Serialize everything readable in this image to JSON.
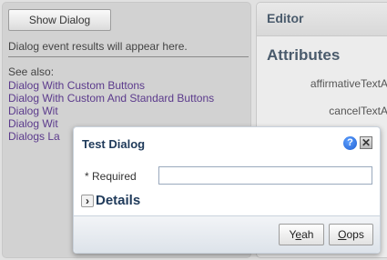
{
  "left": {
    "show_dialog_label": "Show Dialog",
    "results_text": "Dialog event results will appear here.",
    "see_also_label": "See also:",
    "see_also_links": [
      "Dialog With Custom Buttons",
      "Dialog With Custom And Standard Buttons",
      "Dialog Wit",
      "Dialog Wit",
      "Dialogs La"
    ]
  },
  "editor": {
    "title": "Editor",
    "attributes_title": "Attributes",
    "attributes": [
      "affirmativeTextAr",
      "cancelTextAr"
    ]
  },
  "dialog": {
    "title": "Test Dialog",
    "help_glyph": "?",
    "close_glyph": "✕",
    "required_star": "*",
    "required_label": "Required",
    "required_value": "",
    "details_chevron": "›",
    "details_label": "Details",
    "yeah_label_pre": "Y",
    "yeah_label_mnemonic": "e",
    "yeah_label_post": "ah",
    "oops_label_mnemonic": "O",
    "oops_label_post": "ops"
  },
  "colors": {
    "link": "#5b3a8c",
    "title": "#1f3a5a",
    "help_blue": "#1f5fd1"
  }
}
